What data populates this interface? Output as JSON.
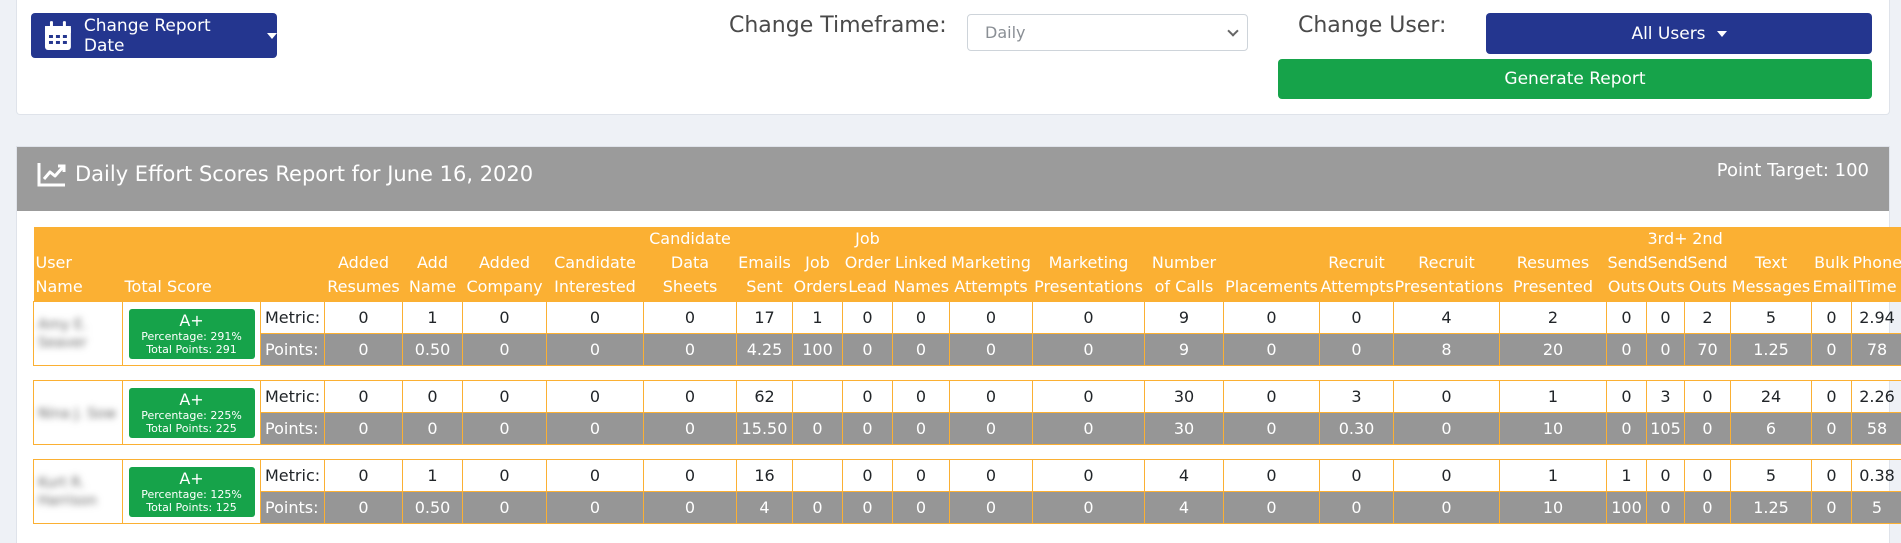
{
  "toolbar": {
    "date_button": "Change Report Date",
    "timeframe_label": "Change Timeframe:",
    "timeframe_value": "Daily",
    "user_label": "Change User:",
    "user_button": "All Users",
    "generate_button": "Generate Report"
  },
  "report": {
    "title": "Daily Effort Scores Report for June 16, 2020",
    "point_target": "Point Target: 100"
  },
  "table": {
    "headers": [
      "User Name",
      "Total Score",
      "",
      "Added Resumes",
      "Add Name",
      "Added Company",
      "Candidate Interested",
      "Candidate Data Sheets",
      "Emails Sent",
      "Job Orders",
      "Job Order Lead",
      "Linked Names",
      "Marketing Attempts",
      "Marketing Presentations",
      "Number of Calls",
      "Placements",
      "Recruit Attempts",
      "Recruit Presentations",
      "Resumes Presented",
      "Send Outs",
      "3rd+ Send Outs",
      "2nd Send Outs",
      "Text Messages",
      "Bulk Email",
      "Phone Time"
    ],
    "metric_label": "Metric:",
    "points_label": "Points:",
    "users": [
      {
        "name": "Amy E. Seaver",
        "grade": "A+",
        "percentage": "Percentage: 291%",
        "total_points": "Total Points: 291",
        "metric": [
          "0",
          "1",
          "0",
          "0",
          "0",
          "17",
          "1",
          "0",
          "0",
          "0",
          "0",
          "9",
          "0",
          "0",
          "4",
          "2",
          "0",
          "0",
          "2",
          "5",
          "0",
          "2.94"
        ],
        "points": [
          "0",
          "0.50",
          "0",
          "0",
          "0",
          "4.25",
          "100",
          "0",
          "0",
          "0",
          "0",
          "9",
          "0",
          "0",
          "8",
          "20",
          "0",
          "0",
          "70",
          "1.25",
          "0",
          "78"
        ]
      },
      {
        "name": "Nina J. Sow",
        "grade": "A+",
        "percentage": "Percentage: 225%",
        "total_points": "Total Points: 225",
        "metric": [
          "0",
          "0",
          "0",
          "0",
          "0",
          "62",
          "",
          "0",
          "0",
          "0",
          "0",
          "30",
          "0",
          "3",
          "0",
          "1",
          "0",
          "3",
          "0",
          "24",
          "0",
          "2.26"
        ],
        "points": [
          "0",
          "0",
          "0",
          "0",
          "0",
          "15.50",
          "0",
          "0",
          "0",
          "0",
          "0",
          "30",
          "0",
          "0.30",
          "0",
          "10",
          "0",
          "105",
          "0",
          "6",
          "0",
          "58"
        ]
      },
      {
        "name": "Kurt R. Harrison",
        "grade": "A+",
        "percentage": "Percentage: 125%",
        "total_points": "Total Points: 125",
        "metric": [
          "0",
          "1",
          "0",
          "0",
          "0",
          "16",
          "",
          "0",
          "0",
          "0",
          "0",
          "4",
          "0",
          "0",
          "0",
          "1",
          "1",
          "0",
          "0",
          "5",
          "0",
          "0.38"
        ],
        "points": [
          "0",
          "0.50",
          "0",
          "0",
          "0",
          "4",
          "0",
          "0",
          "0",
          "0",
          "0",
          "4",
          "0",
          "0",
          "0",
          "10",
          "100",
          "0",
          "0",
          "1.25",
          "0",
          "5"
        ]
      }
    ]
  },
  "colors": {
    "navy": "#24368f",
    "green": "#16a34a",
    "orange": "#fbb033",
    "gray": "#9b9b9b"
  }
}
